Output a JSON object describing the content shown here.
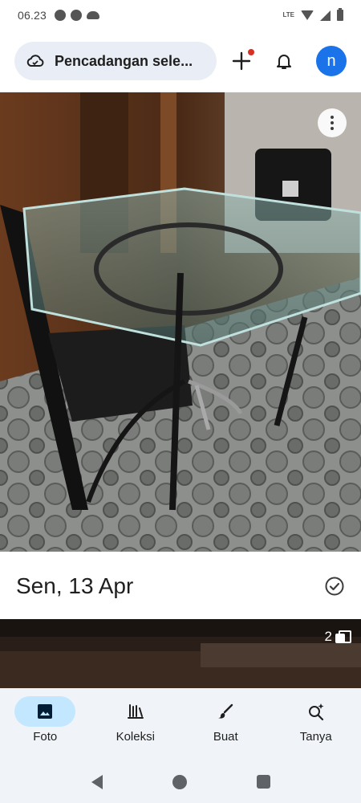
{
  "status_bar": {
    "time": "06.23",
    "network_label": "LTE"
  },
  "top_bar": {
    "backup_label": "Pencadangan sele...",
    "avatar_initial": "n",
    "avatar_color": "#1a73e8",
    "notification_dot_color": "#d93025"
  },
  "section": {
    "date": "Sen, 13 Apr"
  },
  "second_photo": {
    "count": "2"
  },
  "bottom_nav": {
    "items": [
      {
        "label": "Foto",
        "icon": "photo-icon",
        "active": true
      },
      {
        "label": "Koleksi",
        "icon": "library-icon",
        "active": false
      },
      {
        "label": "Buat",
        "icon": "brush-icon",
        "active": false
      },
      {
        "label": "Tanya",
        "icon": "sparkle-search-icon",
        "active": false
      }
    ]
  },
  "colors": {
    "accent": "#1a73e8",
    "active_pill": "#c2e7ff",
    "nav_background": "#f0f4f9",
    "chip_background": "#e9eef6"
  }
}
